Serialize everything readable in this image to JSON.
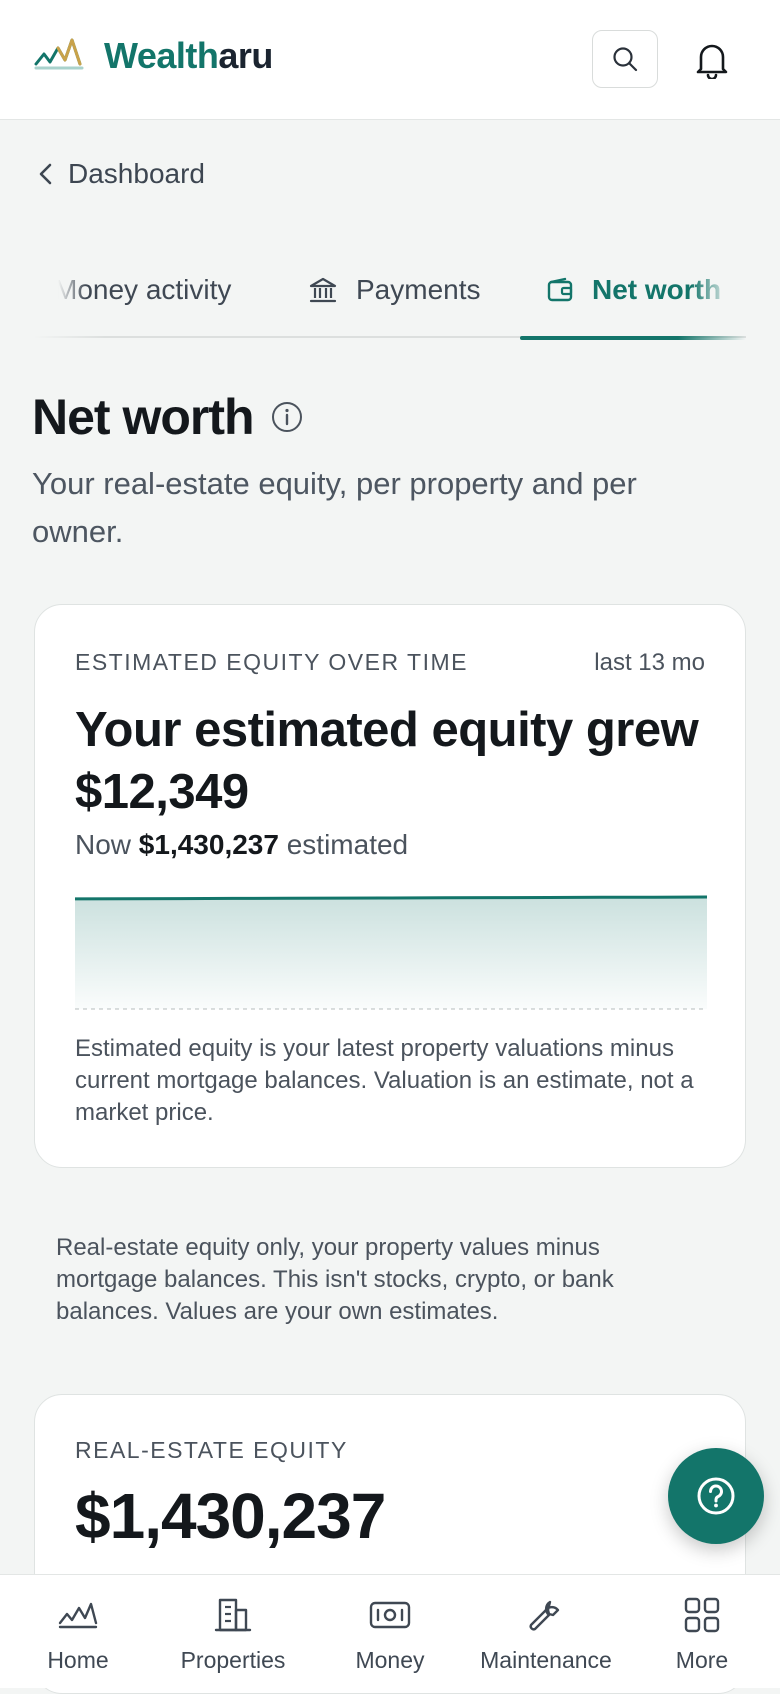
{
  "header": {
    "brand_part1": "Wealth",
    "brand_part2": "aru",
    "logo_icon": "mountain-chart-logo",
    "search_icon": "search-icon",
    "bell_icon": "bell-icon"
  },
  "breadcrumb": {
    "label": "Dashboard",
    "icon": "chevron-left-icon"
  },
  "tabs": [
    {
      "label": "Money activity",
      "icon": "",
      "active": false
    },
    {
      "label": "Payments",
      "icon": "bank-icon",
      "active": false
    },
    {
      "label": "Net worth",
      "icon": "wallet-icon",
      "active": true
    }
  ],
  "page": {
    "title": "Net worth",
    "subtitle": "Your real-estate equity, per property and per owner."
  },
  "equity_card": {
    "eyebrow": "ESTIMATED EQUITY OVER TIME",
    "range": "last 13 mo",
    "headline_line1": "Your estimated equity grew",
    "headline_line2": "$12,349",
    "now_prefix": "Now",
    "now_value": "$1,430,237",
    "now_suffix": "estimated",
    "note": "Estimated equity is your latest property valuations minus current mortgage balances. Valuation is an estimate, not a market price."
  },
  "disclaimer": "Real-estate equity only, your property values minus mortgage balances. This isn't stocks, crypto, or bank balances. Values are your own estimates.",
  "real_estate_card": {
    "eyebrow": "REAL-ESTATE EQUITY",
    "value": "$1,430,237"
  },
  "help_button": {
    "icon": "help-circle-icon"
  },
  "bottom_nav": [
    {
      "label": "Home",
      "icon": "home-chart-icon"
    },
    {
      "label": "Properties",
      "icon": "building-icon"
    },
    {
      "label": "Money",
      "icon": "banknote-icon"
    },
    {
      "label": "Maintenance",
      "icon": "wrench-icon"
    },
    {
      "label": "More",
      "icon": "grid-icon"
    }
  ],
  "colors": {
    "brand": "#13756a",
    "text": "#14181c",
    "muted": "#4b535d",
    "background": "#f3f5f4"
  },
  "chart_data": {
    "type": "area",
    "title": "ESTIMATED EQUITY OVER TIME",
    "x_range": "last 13 mo",
    "values": [
      1417888,
      1418917,
      1419946,
      1420975,
      1422004,
      1423033,
      1424062,
      1425091,
      1426120,
      1427149,
      1428178,
      1429207,
      1430237
    ],
    "grid": false
  }
}
